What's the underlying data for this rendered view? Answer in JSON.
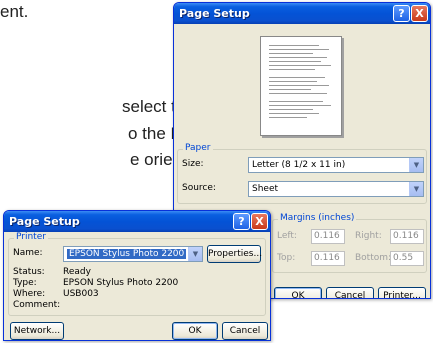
{
  "doc": {
    "line1": "ent.",
    "line2": "select the",
    "line3": "o the Page",
    "line4": "e orientation."
  },
  "page_setup": {
    "title": "Page Setup",
    "help_label": "?",
    "close_label": "X",
    "paper_group": "Paper",
    "size_label": "Size:",
    "size_value": "Letter (8 1/2 x 11 in)",
    "source_label": "Source:",
    "source_value": "Sheet",
    "margins_group": "Margins (inches)",
    "left_label": "Left:",
    "left_value": "0.116",
    "right_label": "Right:",
    "right_value": "0.116",
    "top_label": "Top:",
    "top_value": "0.116",
    "bottom_label": "Bottom:",
    "bottom_value": "0.55",
    "ok_label": "OK",
    "cancel_label": "Cancel",
    "printer_label": "Printer..."
  },
  "printer_dialog": {
    "title": "Page Setup",
    "help_label": "?",
    "close_label": "X",
    "printer_group": "Printer",
    "name_label": "Name:",
    "name_value": "EPSON Stylus Photo 2200",
    "properties_label": "Properties...",
    "status_label": "Status:",
    "status_value": "Ready",
    "type_label": "Type:",
    "type_value": "EPSON Stylus Photo 2200",
    "where_label": "Where:",
    "where_value": "USB003",
    "comment_label": "Comment:",
    "network_label": "Network...",
    "ok_label": "OK",
    "cancel_label": "Cancel"
  },
  "colors": {
    "titlebar": "#0a5fe0",
    "dialog_bg": "#ece9d8",
    "group_label": "#0046d5",
    "selection": "#316ac5"
  }
}
